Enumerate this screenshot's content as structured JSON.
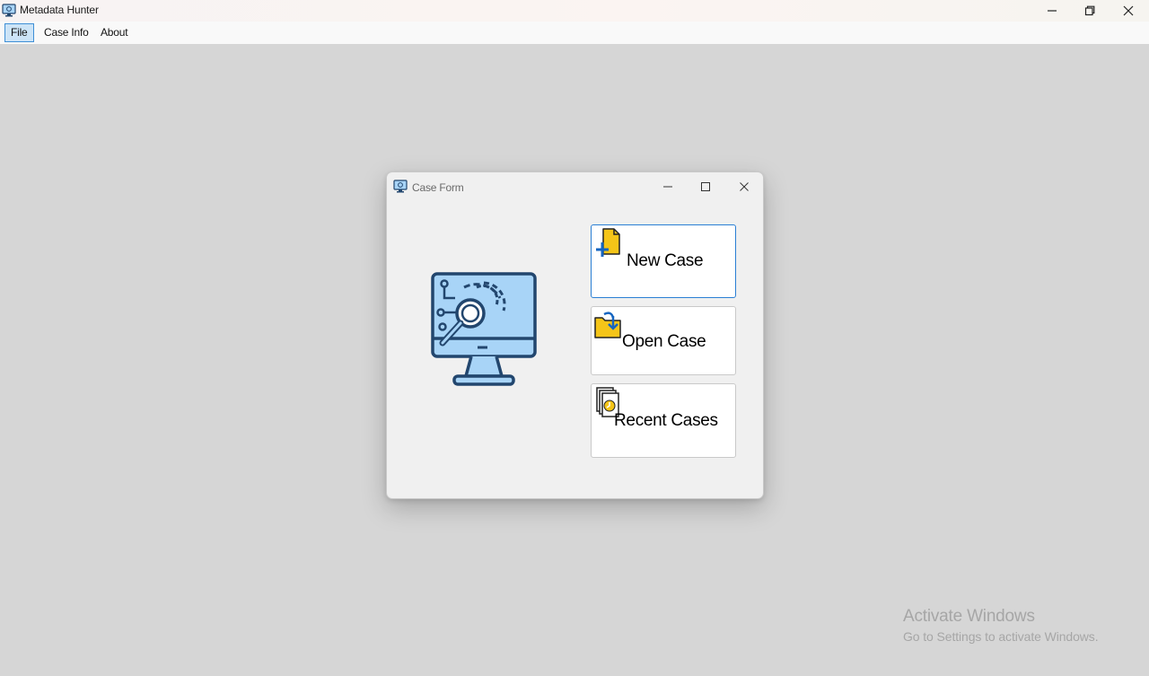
{
  "window": {
    "title": "Metadata Hunter"
  },
  "menu": {
    "items": [
      {
        "label": "File",
        "active": true
      },
      {
        "label": "Case Info",
        "active": false
      },
      {
        "label": "About",
        "active": false
      }
    ]
  },
  "dialog": {
    "title": "Case Form",
    "illustration": "monitor-fingerprint-search-icon",
    "buttons": [
      {
        "label": "New Case",
        "icon": "new-file-plus-icon"
      },
      {
        "label": "Open Case",
        "icon": "open-folder-icon"
      },
      {
        "label": "Recent Cases",
        "icon": "recent-files-clock-icon"
      }
    ]
  },
  "watermark": {
    "title": "Activate Windows",
    "subtitle": "Go to Settings to activate Windows."
  },
  "colors": {
    "desktop_bg": "#d6d6d6",
    "dialog_bg": "#f0f0f0",
    "focus_border": "#2a7fd4",
    "illustration_stroke": "#22466e",
    "illustration_fill": "#a8d4f7",
    "icon_yellow": "#f5c518"
  }
}
